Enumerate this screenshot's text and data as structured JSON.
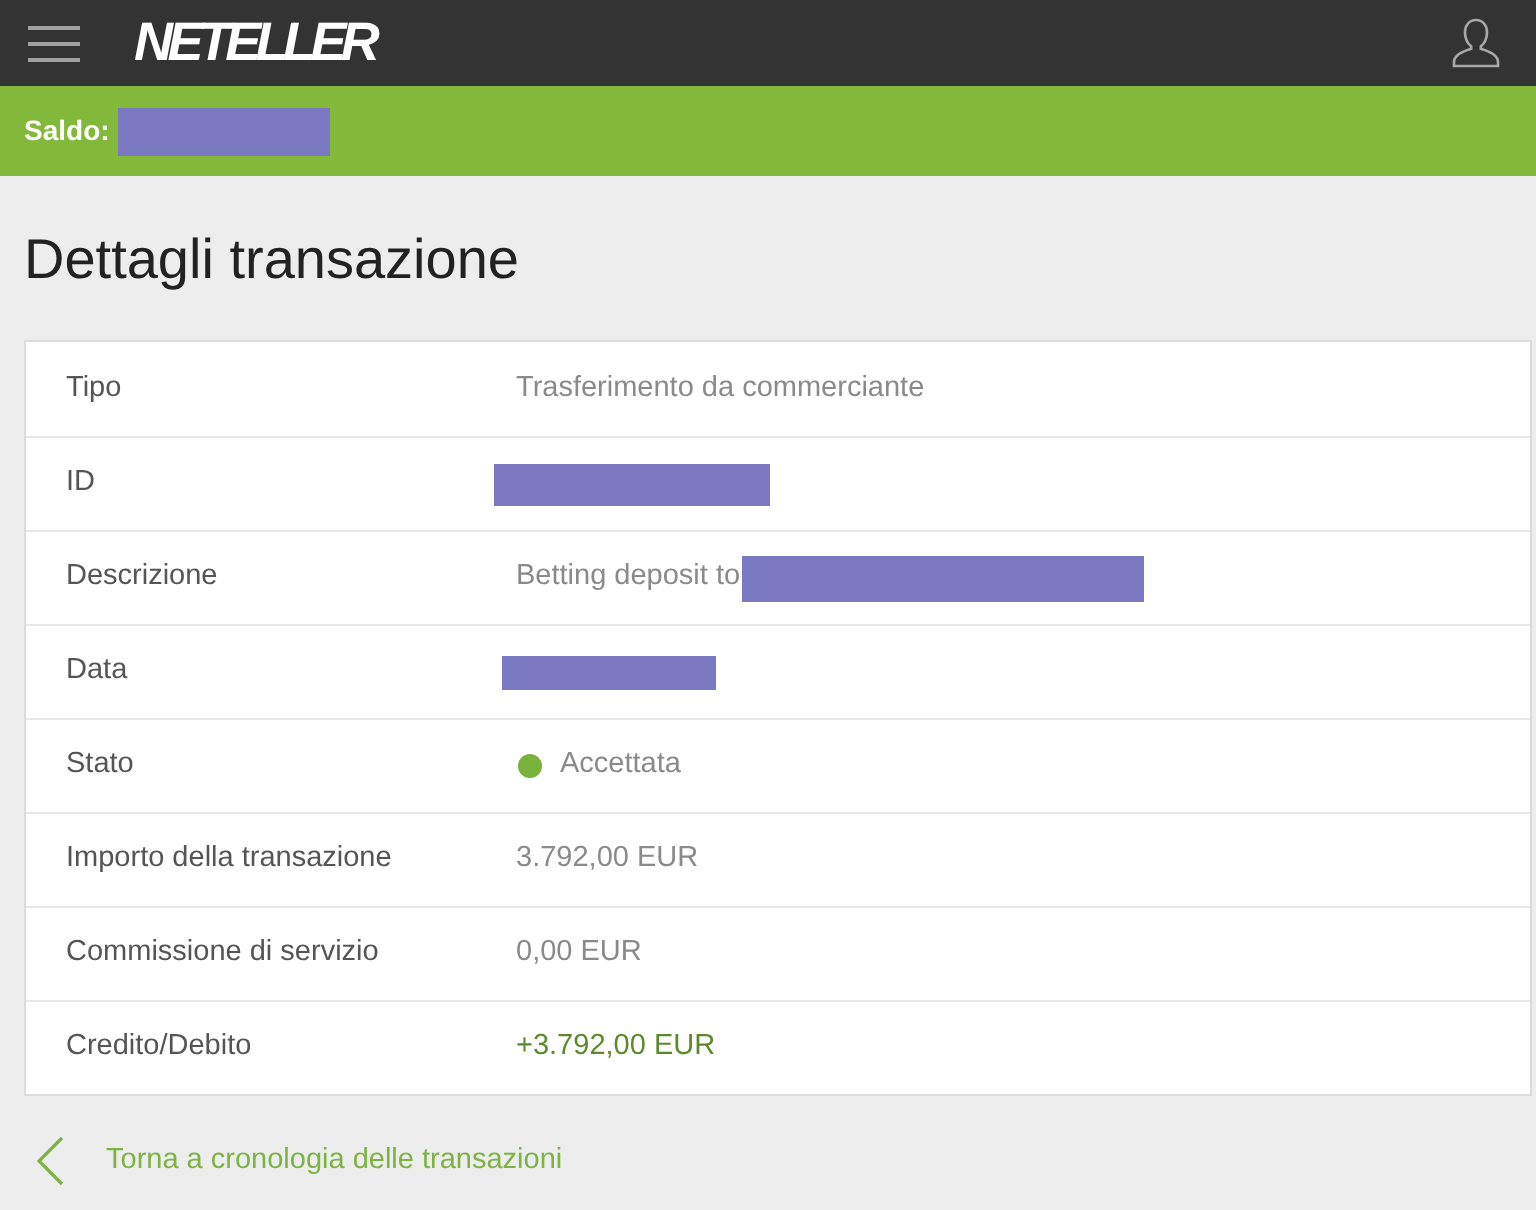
{
  "header": {
    "logo": "NETELLER"
  },
  "balance_bar": {
    "label": "Saldo:",
    "redacted": true
  },
  "title": "Dettagli transazione",
  "details": [
    {
      "kind": "text",
      "label": "Tipo",
      "value": "Trasferimento da commerciante"
    },
    {
      "kind": "text",
      "label": "ID",
      "redacted": true
    },
    {
      "kind": "text",
      "label": "Descrizione",
      "value": "Betting deposit to",
      "redacted": true
    },
    {
      "kind": "text",
      "label": "Data",
      "redacted": true
    },
    {
      "kind": "status",
      "label": "Stato",
      "value": "Accettata",
      "color": "#78b13c"
    },
    {
      "kind": "text",
      "label": "Importo della transazione",
      "value": "3.792,00 EUR"
    },
    {
      "kind": "text",
      "label": "Commissione di servizio",
      "value": "0,00 EUR"
    },
    {
      "kind": "credit",
      "label": "Credito/Debito",
      "value": "+3.792,00 EUR"
    }
  ],
  "back_link": {
    "label": "Torna a cronologia delle transazioni"
  }
}
